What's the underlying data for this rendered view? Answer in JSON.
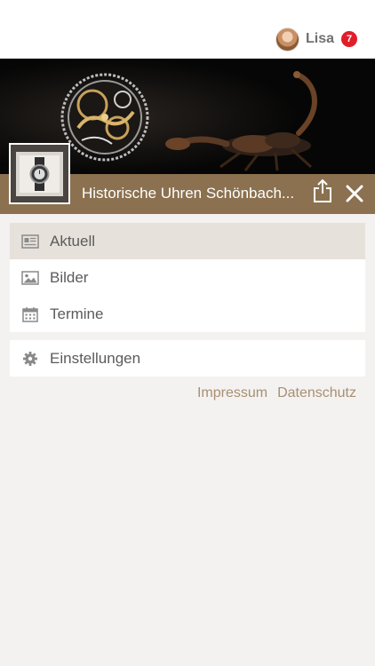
{
  "header": {
    "user_name": "Lisa",
    "notification_count": "7"
  },
  "shop": {
    "title": "Historische Uhren Schönbach..."
  },
  "menu": {
    "items": [
      {
        "label": "Aktuell",
        "icon": "news-icon",
        "active": true
      },
      {
        "label": "Bilder",
        "icon": "image-icon",
        "active": false
      },
      {
        "label": "Termine",
        "icon": "calendar-icon",
        "active": false
      }
    ]
  },
  "settings": {
    "label": "Einstellungen",
    "icon": "gear-icon"
  },
  "footer": {
    "impressum": "Impressum",
    "datenschutz": "Datenschutz"
  },
  "colors": {
    "accent": "#8b7150",
    "badge": "#e01e2a",
    "link": "#a88f74",
    "active_item": "#e6e1da"
  }
}
